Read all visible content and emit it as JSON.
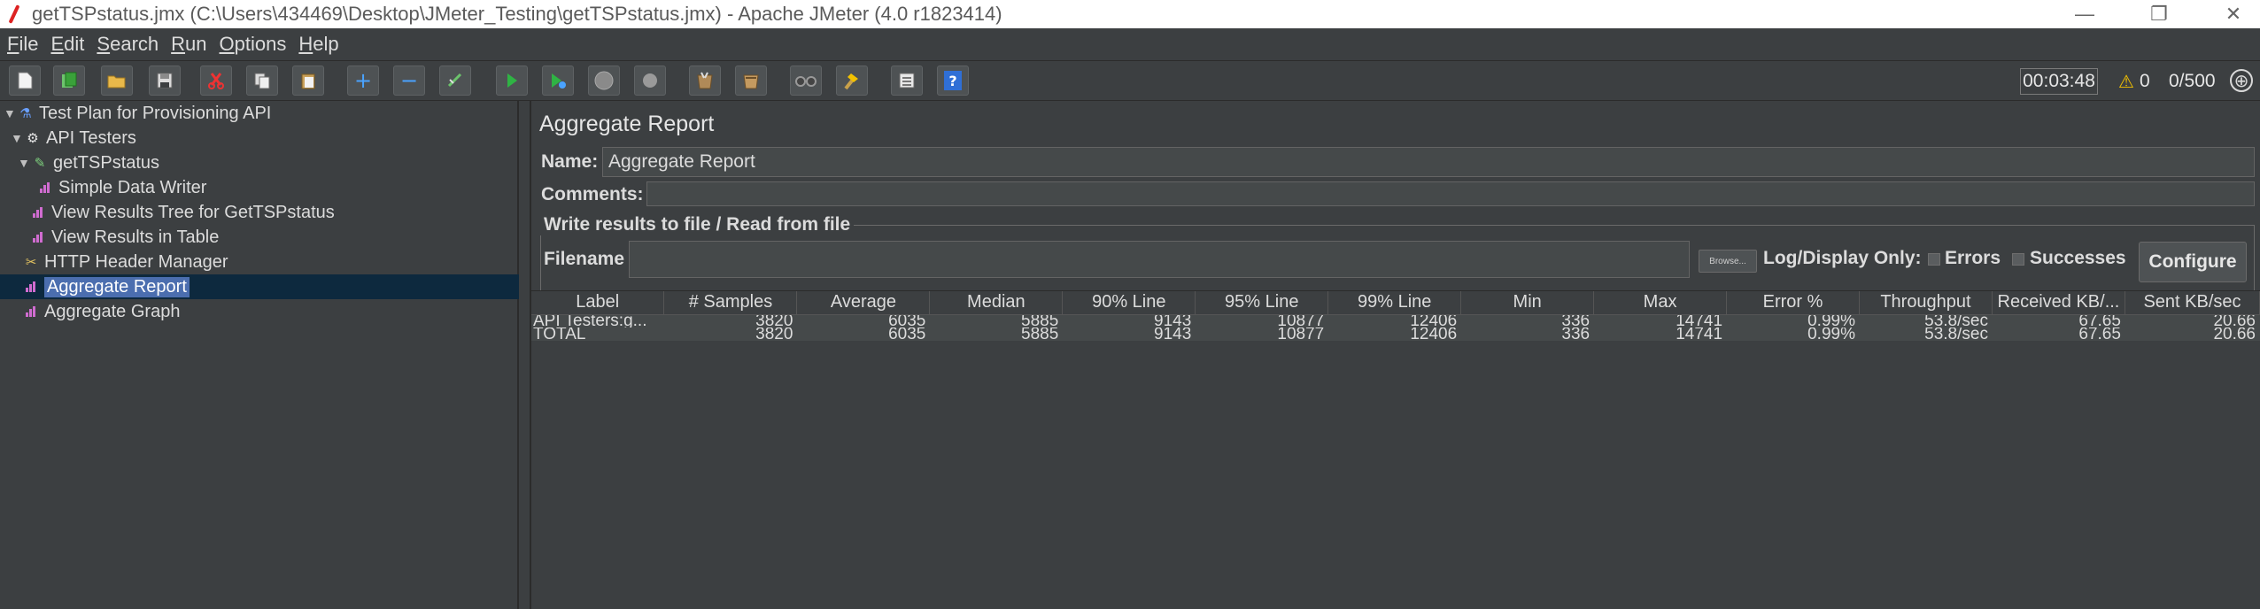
{
  "window": {
    "title": "getTSPstatus.jmx (C:\\Users\\434469\\Desktop\\JMeter_Testing\\getTSPstatus.jmx) - Apache JMeter (4.0 r1823414)",
    "minimize": "—",
    "maximize": "❐",
    "close": "✕"
  },
  "menu": {
    "items": [
      {
        "first": "F",
        "rest": "ile"
      },
      {
        "first": "E",
        "rest": "dit"
      },
      {
        "first": "S",
        "rest": "earch"
      },
      {
        "first": "R",
        "rest": "un"
      },
      {
        "first": "O",
        "rest": "ptions"
      },
      {
        "first": "H",
        "rest": "elp"
      }
    ]
  },
  "toolbar": {
    "timer": "00:03:48",
    "warnings": "0",
    "threads": "0/500",
    "icons": {
      "new": "new-icon",
      "templates": "templates-icon",
      "open": "open-icon",
      "save": "save-icon",
      "cut": "cut-icon",
      "copy": "copy-icon",
      "paste": "paste-icon",
      "expand": "expand-icon",
      "collapse": "collapse-icon",
      "toggle": "toggle-icon",
      "start": "start-icon",
      "start_no_pauses": "start-no-pauses-icon",
      "stop": "stop-icon",
      "shutdown": "shutdown-icon",
      "clear": "clear-icon",
      "clear_all": "clear-all-icon",
      "search": "search-icon",
      "reset_search": "reset-search-icon",
      "function_helper": "function-helper-icon",
      "help": "help-icon"
    }
  },
  "tree": {
    "items": [
      {
        "label": "Test Plan for Provisioning API",
        "icon": "test-plan-icon"
      },
      {
        "label": "API Testers",
        "icon": "thread-group-icon"
      },
      {
        "label": "getTSPstatus",
        "icon": "sampler-icon"
      },
      {
        "label": "Simple Data Writer",
        "icon": "listener-icon"
      },
      {
        "label": "View Results Tree for GetTSPstatus",
        "icon": "listener-icon"
      },
      {
        "label": "View Results in Table",
        "icon": "listener-icon"
      },
      {
        "label": "HTTP Header Manager",
        "icon": "config-icon"
      },
      {
        "label": "Aggregate Report",
        "icon": "listener-icon"
      },
      {
        "label": "Aggregate Graph",
        "icon": "listener-icon"
      }
    ]
  },
  "panel": {
    "title": "Aggregate Report",
    "name_label": "Name:",
    "name_value": "Aggregate Report",
    "comments_label": "Comments:",
    "comments_value": "",
    "group_title": "Write results to file / Read from file",
    "filename_label": "Filename",
    "filename_value": "",
    "browse_label": "Browse...",
    "log_display_label": "Log/Display Only:",
    "errors_label": "Errors",
    "successes_label": "Successes",
    "configure_label": "Configure"
  },
  "table": {
    "columns": [
      "Label",
      "# Samples",
      "Average",
      "Median",
      "90% Line",
      "95% Line",
      "99% Line",
      "Min",
      "Max",
      "Error %",
      "Throughput",
      "Received KB/...",
      "Sent KB/sec"
    ],
    "rows": [
      [
        "API Testers:g...",
        "3820",
        "6035",
        "5885",
        "9143",
        "10877",
        "12406",
        "336",
        "14741",
        "0.99%",
        "53.8/sec",
        "67.65",
        "20.66"
      ],
      [
        "TOTAL",
        "3820",
        "6035",
        "5885",
        "9143",
        "10877",
        "12406",
        "336",
        "14741",
        "0.99%",
        "53.8/sec",
        "67.65",
        "20.66"
      ]
    ]
  }
}
